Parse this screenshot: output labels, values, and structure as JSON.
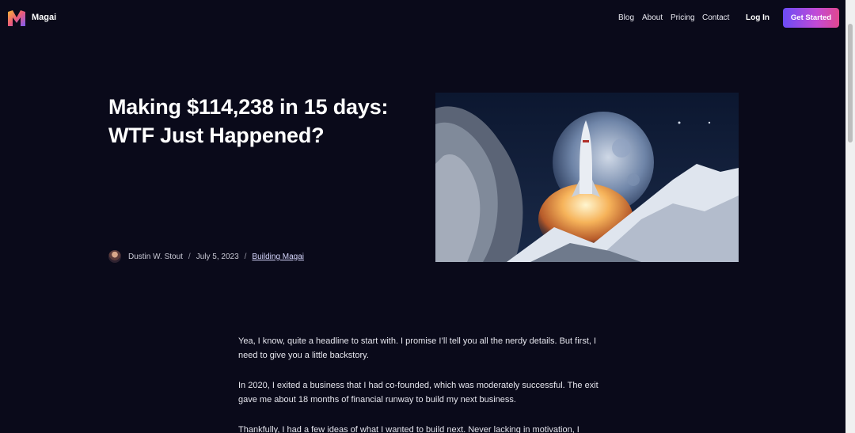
{
  "header": {
    "brand": "Magai",
    "nav": [
      "Blog",
      "About",
      "Pricing",
      "Contact"
    ],
    "login": "Log In",
    "cta": "Get Started"
  },
  "post": {
    "title_line1": "Making $114,238 in 15 days:",
    "title_line2": "WTF Just Happened?",
    "author": "Dustin W. Stout",
    "separator": "/",
    "date": "July 5, 2023",
    "category": "Building Magai"
  },
  "article": {
    "paragraphs": [
      "Yea, I know, quite a headline to start with. I promise I’ll tell you all the nerdy details. But first, I need to give you a little backstory.",
      "In 2020, I exited a business that I had co-founded, which was moderately successful. The exit gave me about 18 months of financial runway to build my next business.",
      "Thankfully, I had a few ideas of what I wanted to build next. Never lacking in motivation, I"
    ]
  },
  "colors": {
    "background": "#0a0a1a",
    "cta_gradient_start": "#6b4cf6",
    "cta_gradient_end": "#e0478f"
  },
  "icons": {
    "logo": "magai-m-logo",
    "avatar": "author-avatar"
  }
}
